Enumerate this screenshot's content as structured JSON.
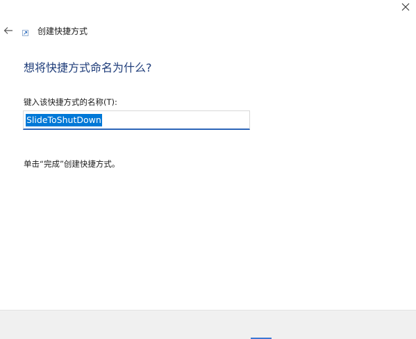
{
  "window": {
    "title": "创建快捷方式",
    "close_icon": "close-icon",
    "back_icon": "back-arrow-icon"
  },
  "main": {
    "heading": "想将快捷方式命名为什么?",
    "name_label": "键入该快捷方式的名称(T):",
    "name_value": "SlideToShutDown",
    "hint": "单击“完成”创建快捷方式。"
  },
  "colors": {
    "heading": "#1f3d7a",
    "selection": "#0078d7",
    "input_underline": "#2b64b8",
    "footer_bg": "#f0f0f0"
  }
}
